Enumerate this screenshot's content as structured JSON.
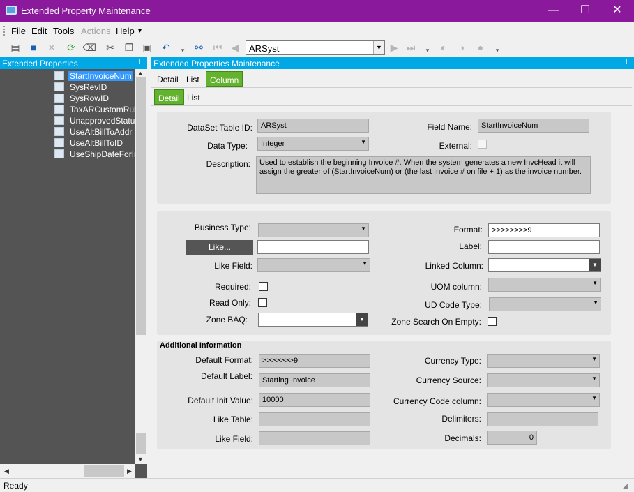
{
  "window": {
    "title": "Extended Property Maintenance",
    "minimize": "—",
    "maximize": "☐",
    "close": "✕"
  },
  "menu": {
    "file": "File",
    "edit": "Edit",
    "tools": "Tools",
    "actions": "Actions",
    "help": "Help",
    "help_arrow": "▾"
  },
  "toolbar": {
    "icons": [
      "new-icon",
      "save-icon",
      "delete-icon",
      "refresh-icon",
      "clear-icon",
      "cut-icon",
      "copy-icon",
      "paste-icon",
      "undo-icon",
      "binoculars-icon",
      "first-record-icon",
      "prev-record-icon",
      "next-record-icon",
      "last-record-icon",
      "back-icon",
      "forward-icon",
      "home-icon"
    ],
    "record_value": "ARSyst",
    "combo_arrow": "▼"
  },
  "left_panel": {
    "title": "Extended Properties",
    "pin": "📌",
    "items": [
      {
        "label": "StartInvoiceNum",
        "selected": true
      },
      {
        "label": "SysRevID",
        "selected": false
      },
      {
        "label": "SysRowID",
        "selected": false
      },
      {
        "label": "TaxARCustomRul",
        "selected": false
      },
      {
        "label": "UnapprovedStatu",
        "selected": false
      },
      {
        "label": "UseAltBillToAddr",
        "selected": false
      },
      {
        "label": "UseAltBillToID",
        "selected": false
      },
      {
        "label": "UseShipDateForIn",
        "selected": false
      }
    ],
    "scroll_up": "▲",
    "scroll_down": "▼",
    "scroll_left": "◀",
    "scroll_right": "▶"
  },
  "right_panel": {
    "title": "Extended Properties Maintenance",
    "pin": "📌",
    "tabs": [
      "Detail",
      "List",
      "Column"
    ],
    "active_tab": "Column",
    "subtabs": [
      "Detail",
      "List"
    ],
    "active_subtab": "Detail"
  },
  "top_group": {
    "dataset_label": "DataSet Table ID:",
    "dataset_value": "ARSyst",
    "field_name_label": "Field Name:",
    "field_name_value": "StartInvoiceNum",
    "data_type_label": "Data Type:",
    "data_type_value": "Integer",
    "external_label": "External:",
    "external_checked": false,
    "description_label": "Description:",
    "description_value": "Used to establish the beginning Invoice #. When the system generates a new InvcHead it will assign the greater of (StartInvoiceNum) or (the last Invoice # on file + 1) as the invoice number."
  },
  "mid_group": {
    "business_type_label": "Business Type:",
    "business_type_value": "",
    "like_button": "Like...",
    "like_value": "",
    "like_field_label": "Like Field:",
    "like_field_value": "",
    "required_label": "Required:",
    "required_checked": false,
    "read_only_label": "Read Only:",
    "read_only_checked": false,
    "zone_baq_label": "Zone BAQ:",
    "zone_baq_value": "",
    "format_label": "Format:",
    "format_value": ">>>>>>>>9",
    "label_label": "Label:",
    "label_value": "",
    "linked_column_label": "Linked Column:",
    "linked_column_value": "",
    "uom_column_label": "UOM column:",
    "uom_column_value": "",
    "ud_code_type_label": "UD Code Type:",
    "ud_code_type_value": "",
    "zone_search_label": "Zone Search On Empty:",
    "zone_search_checked": false
  },
  "additional": {
    "title": "Additional Information",
    "default_format_label": "Default Format:",
    "default_format_value": ">>>>>>>9",
    "default_label_label": "Default Label:",
    "default_label_value": "Starting Invoice",
    "default_init_label": "Default Init Value:",
    "default_init_value": "10000",
    "like_table_label": "Like Table:",
    "like_table_value": "",
    "like_field_label": "Like Field:",
    "like_field_value": "",
    "currency_type_label": "Currency Type:",
    "currency_type_value": "",
    "currency_source_label": "Currency Source:",
    "currency_source_value": "",
    "currency_code_label": "Currency Code column:",
    "currency_code_value": "",
    "delimiters_label": "Delimiters:",
    "delimiters_value": "",
    "decimals_label": "Decimals:",
    "decimals_value": "0"
  },
  "status": {
    "text": "Ready"
  },
  "colors": {
    "titlebar": "#8a1a9b",
    "panel_header": "#00a8e6",
    "active_tab": "#63b32e",
    "selection": "#3399ff"
  }
}
